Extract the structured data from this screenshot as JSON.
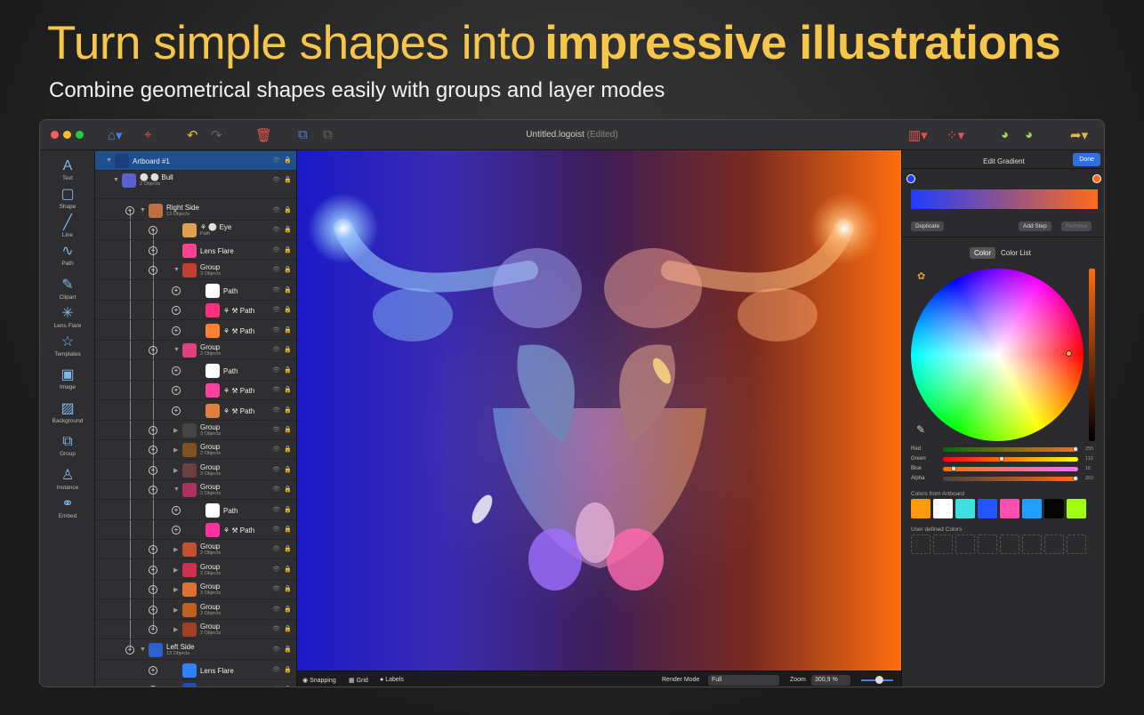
{
  "headline": {
    "part1": "Turn simple shapes into",
    "part2": "impressive illustrations"
  },
  "subline": "Combine geometrical shapes easily with groups and layer modes",
  "window": {
    "title": "Untitled.logoist",
    "edited": "(Edited)"
  },
  "toolbar": {
    "icons": [
      "artboard-icon",
      "target-icon",
      "undo-icon",
      "redo-icon",
      "trash-icon",
      "duplicate-icon",
      "arrange-icon",
      "chart-icon",
      "distribute-icon",
      "palette-icon",
      "palette-alt-icon",
      "share-icon"
    ]
  },
  "tools": [
    {
      "label": "Text",
      "glyph": "A"
    },
    {
      "label": "Shape",
      "glyph": "▢"
    },
    {
      "label": "Line",
      "glyph": "╱"
    },
    {
      "label": "Path",
      "glyph": "∿"
    },
    {
      "label": "Clipart",
      "glyph": "✎"
    },
    {
      "label": "Lens Flare",
      "glyph": "✳"
    },
    {
      "label": "Templates",
      "glyph": "☆"
    },
    {
      "label": "Image",
      "glyph": "▣"
    },
    {
      "label": "Background",
      "glyph": "▨"
    },
    {
      "label": "Group",
      "glyph": "⧉"
    },
    {
      "label": "Instance",
      "glyph": "♙"
    },
    {
      "label": "Embed",
      "glyph": "⚭"
    }
  ],
  "layers": [
    {
      "name": "Artboard #1",
      "sub": ""
    },
    {
      "name": "⚪ ⚪ Bull",
      "sub": "2 Objects"
    },
    {
      "name": "Right Side",
      "sub": "13 Objects"
    },
    {
      "name": "⚘ ⚪ Eye",
      "sub": "Path"
    },
    {
      "name": "Lens Flare",
      "sub": ""
    },
    {
      "name": "Group",
      "sub": "3 Objects"
    },
    {
      "name": "Path",
      "sub": ""
    },
    {
      "name": "⚘ ⚒ Path",
      "sub": ""
    },
    {
      "name": "⚘ ⚒ Path",
      "sub": ""
    },
    {
      "name": "Group",
      "sub": "3 Objects"
    },
    {
      "name": "Path",
      "sub": ""
    },
    {
      "name": "⚘ ⚒ Path",
      "sub": ""
    },
    {
      "name": "⚘ ⚒ Path",
      "sub": ""
    },
    {
      "name": "Group",
      "sub": "3 Objects"
    },
    {
      "name": "Group",
      "sub": "2 Objects"
    },
    {
      "name": "Group",
      "sub": "3 Objects"
    },
    {
      "name": "Group",
      "sub": "2 Objects"
    },
    {
      "name": "Path",
      "sub": ""
    },
    {
      "name": "⚘ ⚒ Path",
      "sub": ""
    },
    {
      "name": "Group",
      "sub": "3 Objects"
    },
    {
      "name": "Group",
      "sub": "2 Objects"
    },
    {
      "name": "Group",
      "sub": "3 Objects"
    },
    {
      "name": "Group",
      "sub": "2 Objects"
    },
    {
      "name": "Group",
      "sub": "2 Objects"
    },
    {
      "name": "Left Side",
      "sub": "13 Objects"
    },
    {
      "name": "Lens Flare",
      "sub": ""
    },
    {
      "name": "⚘ ⚪ Eye",
      "sub": ""
    }
  ],
  "statusbar": {
    "snapping": "Snapping",
    "grid": "Grid",
    "labels": "Labels",
    "render_mode_label": "Render Mode",
    "render_mode_value": "Full",
    "zoom_label": "Zoom",
    "zoom_value": "300,9 %"
  },
  "panel": {
    "title": "Edit Gradient",
    "done": "Done",
    "duplicate": "Duplicate",
    "add_step": "Add Step",
    "remove": "Remove",
    "tab_color": "Color",
    "tab_color_list": "Color List",
    "gradient_start": "#1f3dff",
    "gradient_end": "#ff6a1a",
    "sliders": [
      {
        "label": "Red",
        "value": "255",
        "fraction": 1.0
      },
      {
        "label": "Green",
        "value": "110",
        "fraction": 0.43
      },
      {
        "label": "Blue",
        "value": "16",
        "fraction": 0.06
      },
      {
        "label": "Alpha",
        "value": "255",
        "fraction": 1.0
      }
    ],
    "colors_from_artboard_label": "Colors from Artboard",
    "artboard_colors": [
      "#ff9a0a",
      "#ffffff",
      "#3ee0e0",
      "#2255ff",
      "#ff4fb0",
      "#22a0ff",
      "#050505",
      "#a0ff10"
    ],
    "user_colors_label": "User defined Colors"
  }
}
